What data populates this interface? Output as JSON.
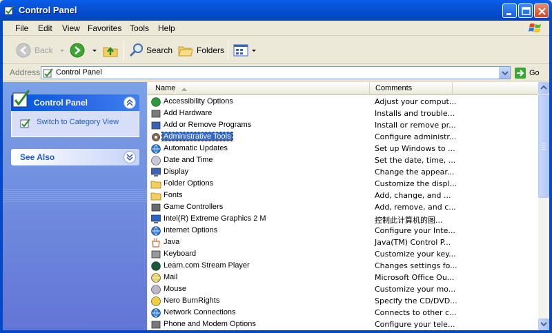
{
  "window": {
    "title": "Control Panel",
    "app_icon": "control-panel-icon"
  },
  "menubar": {
    "items": [
      "File",
      "Edit",
      "View",
      "Favorites",
      "Tools",
      "Help"
    ]
  },
  "toolbar": {
    "back_label": "Back",
    "search_label": "Search",
    "folders_label": "Folders"
  },
  "addressbar": {
    "label": "Address",
    "value": "Control Panel",
    "go_label": "Go"
  },
  "leftpane": {
    "control_panel_title": "Control Panel",
    "switch_view_link": "Switch to Category View",
    "see_also_title": "See Also"
  },
  "columns": {
    "name": "Name",
    "comments": "Comments"
  },
  "items": [
    {
      "name": "Accessibility Options",
      "comment": "Adjust your comput...",
      "icon": "accessibility-icon"
    },
    {
      "name": "Add Hardware",
      "comment": "Installs and trouble...",
      "icon": "hardware-icon"
    },
    {
      "name": "Add or Remove Programs",
      "comment": "Install or remove pr...",
      "icon": "programs-icon"
    },
    {
      "name": "Administrative Tools",
      "comment": "Configure administr...",
      "icon": "admin-tools-icon",
      "selected": true
    },
    {
      "name": "Automatic Updates",
      "comment": "Set up Windows to ...",
      "icon": "updates-icon"
    },
    {
      "name": "Date and Time",
      "comment": "Set the date, time, ...",
      "icon": "clock-icon"
    },
    {
      "name": "Display",
      "comment": "Change the appear...",
      "icon": "display-icon"
    },
    {
      "name": "Folder Options",
      "comment": "Customize the displ...",
      "icon": "folder-icon"
    },
    {
      "name": "Fonts",
      "comment": "Add, change, and ...",
      "icon": "fonts-folder-icon"
    },
    {
      "name": "Game Controllers",
      "comment": "Add, remove, and c...",
      "icon": "gamepad-icon"
    },
    {
      "name": "Intel(R) Extreme Graphics 2 M",
      "comment": "控制此计算机的图...",
      "icon": "intel-graphics-icon"
    },
    {
      "name": "Internet Options",
      "comment": "Configure your Inte...",
      "icon": "internet-icon"
    },
    {
      "name": "Java",
      "comment": "Java(TM) Control P...",
      "icon": "java-icon"
    },
    {
      "name": "Keyboard",
      "comment": "Customize your key...",
      "icon": "keyboard-icon"
    },
    {
      "name": "Learn.com Stream Player",
      "comment": "Changes settings fo...",
      "icon": "stream-player-icon"
    },
    {
      "name": "Mail",
      "comment": "Microsoft Office Ou...",
      "icon": "mail-icon"
    },
    {
      "name": "Mouse",
      "comment": "Customize your mo...",
      "icon": "mouse-icon"
    },
    {
      "name": "Nero BurnRights",
      "comment": "Specify the CD/DVD...",
      "icon": "nero-icon"
    },
    {
      "name": "Network Connections",
      "comment": "Connects to other c...",
      "icon": "network-icon"
    },
    {
      "name": "Phone and Modem Options",
      "comment": "Configure your tele...",
      "icon": "phone-icon"
    }
  ]
}
